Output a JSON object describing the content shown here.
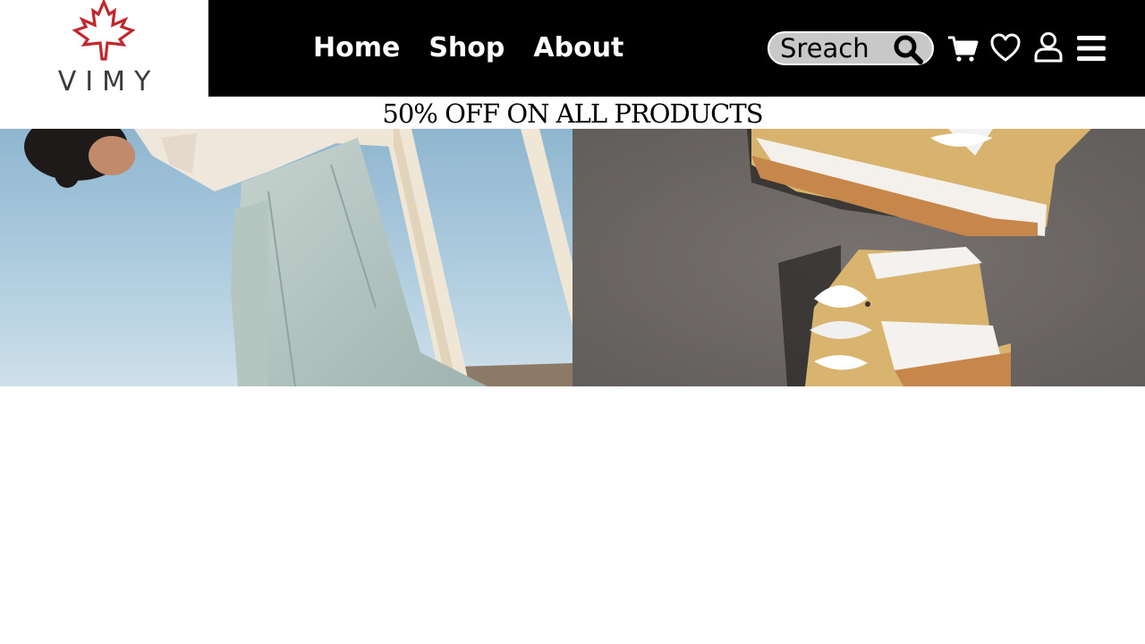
{
  "brand": {
    "name": "VIMY",
    "logo_icon": "maple-leaf-icon",
    "logo_color": "#c0282d"
  },
  "nav": {
    "items": [
      {
        "label": "Home"
      },
      {
        "label": "Shop"
      },
      {
        "label": "About"
      }
    ]
  },
  "search": {
    "placeholder": "Sreach",
    "icon": "search-icon"
  },
  "header_icons": [
    "cart-icon",
    "heart-icon",
    "user-icon",
    "menu-icon"
  ],
  "promo": {
    "text": "50% OFF ON ALL PRODUCTS"
  },
  "hero": {
    "left_image": "person-in-light-jeans-on-railing",
    "right_image": "tan-sneakers-on-concrete"
  },
  "colors": {
    "header_bg": "#000000",
    "search_bg": "#c8c8c8",
    "accent": "#c0282d"
  }
}
